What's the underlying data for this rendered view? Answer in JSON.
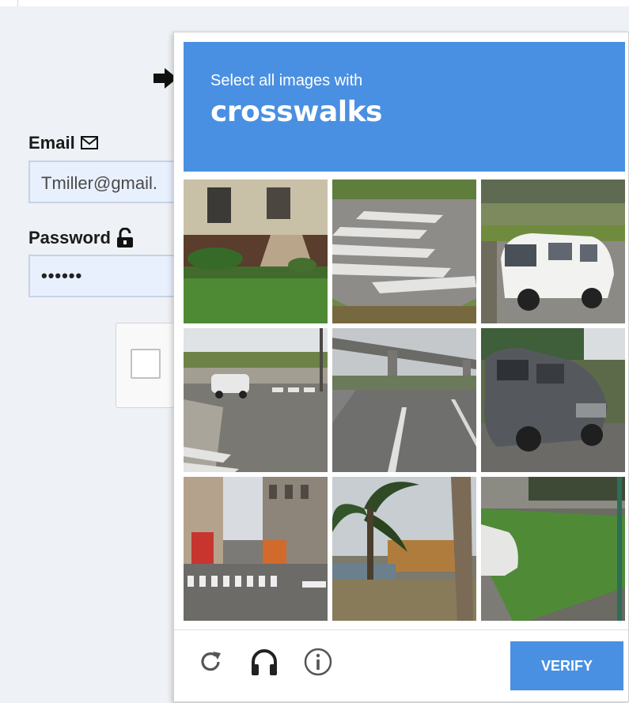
{
  "login_form": {
    "email_label": "Email",
    "email_value": "Tmiller@gmail.",
    "password_label": "Password",
    "password_value": "••••••"
  },
  "icons": {
    "arrow": "arrow-right-icon",
    "email": "envelope-icon",
    "password": "unlock-icon",
    "reload": "reload-icon",
    "audio": "headphones-icon",
    "info": "info-icon"
  },
  "captcha": {
    "instruction": "Select all images with",
    "keyword": "crosswalks",
    "verify_label": "VERIFY",
    "header_color": "#4a90e2",
    "tiles": [
      {
        "name": "house-porch"
      },
      {
        "name": "crosswalk-closeup"
      },
      {
        "name": "white-van"
      },
      {
        "name": "intersection-crosswalk"
      },
      {
        "name": "highway-overpass"
      },
      {
        "name": "grey-suv"
      },
      {
        "name": "city-street-crosswalk"
      },
      {
        "name": "palm-tree"
      },
      {
        "name": "parked-car-grass"
      }
    ]
  }
}
